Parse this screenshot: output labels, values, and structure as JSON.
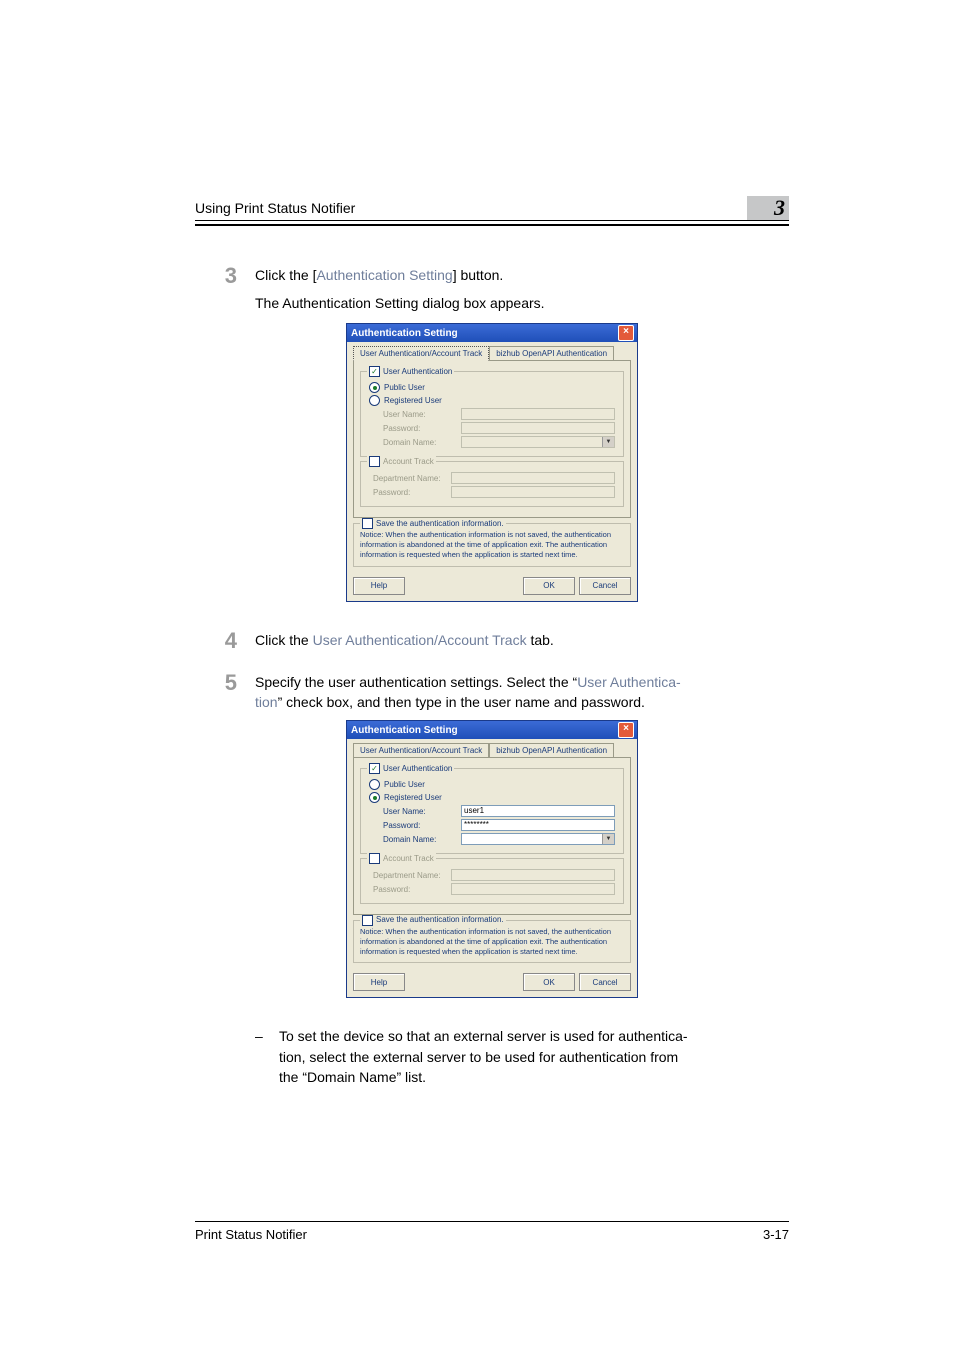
{
  "header": {
    "title": "Using Print Status Notifier",
    "chapter": "3"
  },
  "steps": {
    "s3": {
      "num": "3",
      "prefix": "Click the [",
      "em": "Authentication Setting",
      "suffix": "] button.",
      "sub": "The Authentication Setting dialog box appears."
    },
    "s4": {
      "num": "4",
      "prefix": "Click the ",
      "em": "User Authentication/Account Track",
      "suffix": " tab."
    },
    "s5": {
      "num": "5",
      "line1_prefix": "Specify the user authentication settings. Select the “",
      "line1_em": "User Authentica-",
      "line2_em": "tion",
      "line2_suffix": "” check box, and then type in the user name and password."
    },
    "bullet": {
      "dash": "–",
      "t1": "To set the device so that an external server is used for authentica-",
      "t2": "tion, select the external server to be used for authentication from",
      "t3_prefix": "the “",
      "t3_em": "Domain Name",
      "t3_suffix": "” list."
    }
  },
  "dialog1": {
    "title": "Authentication Setting",
    "tab1": "User Authentication/Account Track",
    "tab2": "bizhub OpenAPI Authentication",
    "user_auth": "User Authentication",
    "public_user": "Public User",
    "registered_user": "Registered User",
    "user_name": "User Name:",
    "password": "Password:",
    "domain_name": "Domain Name:",
    "account_track": "Account Track",
    "dept_name": "Department Name:",
    "acct_password": "Password:",
    "save_info": "Save the authentication information.",
    "notice": "Notice: When the authentication information is not saved, the authentication information is abandoned at the time of application exit.  The authentication information is requested when the application is started next time.",
    "help": "Help",
    "ok": "OK",
    "cancel": "Cancel",
    "user_value": "",
    "pass_value": ""
  },
  "dialog2": {
    "user_value": "user1",
    "pass_value": "********"
  },
  "footer": {
    "left": "Print Status Notifier",
    "right": "3-17"
  }
}
